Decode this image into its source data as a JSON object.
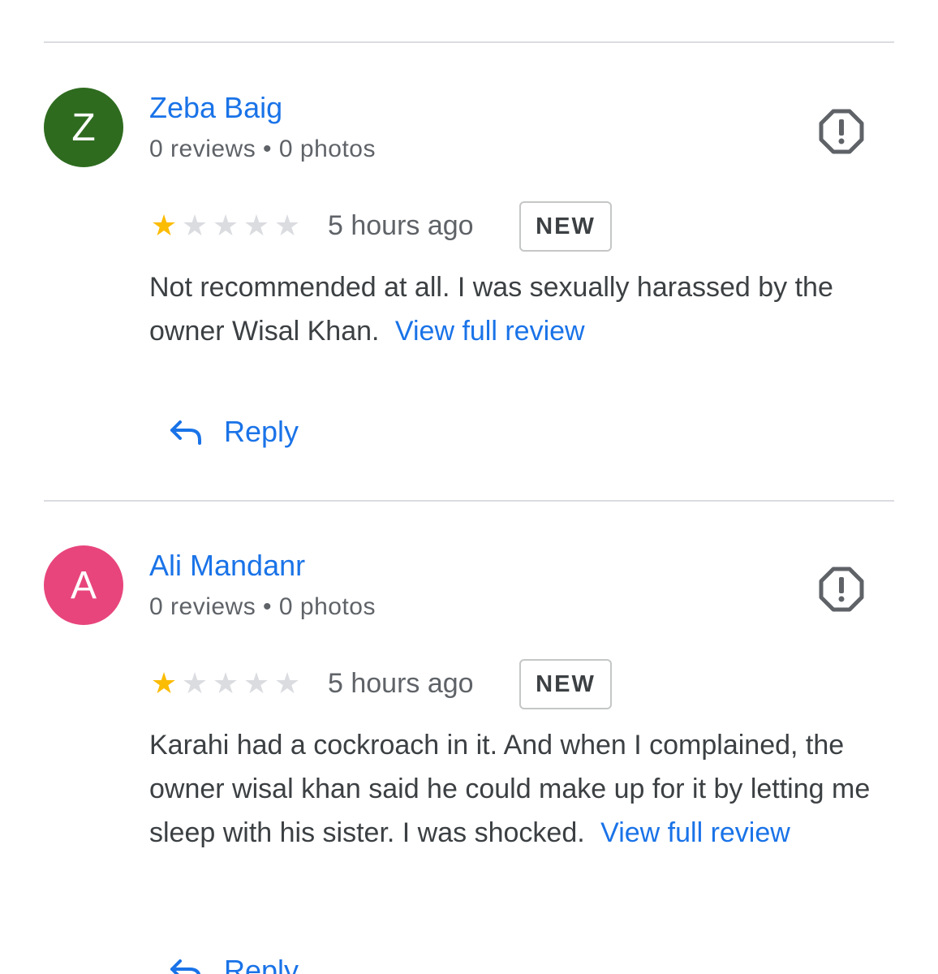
{
  "reviews": [
    {
      "author": "Zeba Baig",
      "initial": "Z",
      "avatar_color": "#2e6b1f",
      "meta": "0 reviews • 0 photos",
      "rating": 1,
      "time": "5 hours ago",
      "badge": "NEW",
      "text": "Not recommended at all. I was sexually harassed by the owner Wisal Khan.",
      "more": "View full review",
      "reply": "Reply"
    },
    {
      "author": "Ali Mandanr",
      "initial": "A",
      "avatar_color": "#e8457d",
      "meta": "0 reviews • 0 photos",
      "rating": 1,
      "time": "5 hours ago",
      "badge": "NEW",
      "text": "Karahi had a cockroach in it. And when I complained, the owner wisal khan said he could make up for it by letting me sleep with his sister. I was shocked.",
      "more": "View full review",
      "reply": "Reply"
    }
  ],
  "colors": {
    "link": "#1a73e8",
    "star_filled": "#fbbc04",
    "star_empty": "#dadce0",
    "divider": "#dadce0"
  },
  "icons": {
    "flag": "report-flag-icon",
    "reply": "reply-arrow-icon",
    "star": "star-icon"
  }
}
